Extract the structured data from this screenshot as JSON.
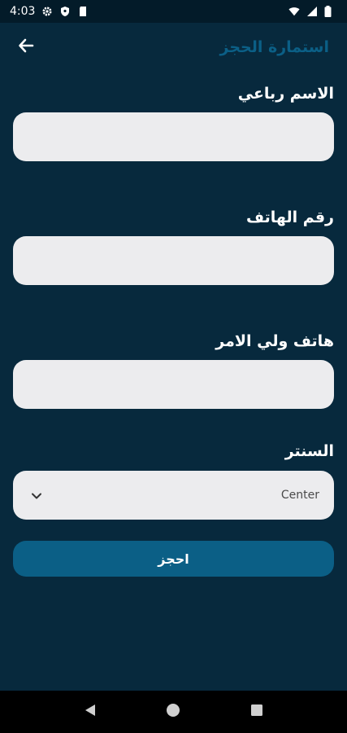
{
  "status_bar": {
    "time": "4:03",
    "left_icons": [
      "gear-icon",
      "shield-icon",
      "sd-card-icon"
    ],
    "right_icons": [
      "wifi-icon",
      "signal-icon",
      "battery-icon"
    ]
  },
  "app_bar": {
    "title": "استمارة الحجز",
    "back_icon": "arrow-left-icon",
    "title_color": "#0b5f86"
  },
  "form": {
    "full_name": {
      "label": "الاسم رباعي",
      "value": "",
      "placeholder": ""
    },
    "phone": {
      "label": "رقم الهاتف",
      "value": "",
      "placeholder": ""
    },
    "guardian_phone": {
      "label": "هاتف ولي الامر",
      "value": "",
      "placeholder": ""
    },
    "center": {
      "label": "السنتر",
      "selected": "Center",
      "icon": "chevron-down-icon"
    },
    "submit_label": "احجز"
  },
  "colors": {
    "background": "#07293d",
    "accent": "#0b5f86",
    "input_bg": "#ececee"
  },
  "nav_bar": {
    "icons": [
      "back-triangle-icon",
      "home-circle-icon",
      "recents-square-icon"
    ]
  }
}
